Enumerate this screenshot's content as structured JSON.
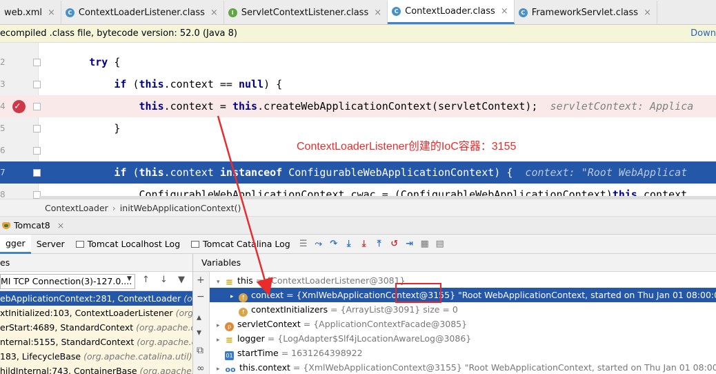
{
  "tabs": [
    {
      "label": "web.xml",
      "icon": "xml-icon"
    },
    {
      "label": "ContextLoaderListener.class",
      "icon": "class-icon"
    },
    {
      "label": "ServletContextListener.class",
      "icon": "interface-icon"
    },
    {
      "label": "ContextLoader.class",
      "icon": "class-icon",
      "active": true
    },
    {
      "label": "FrameworkServlet.class",
      "icon": "class-icon"
    }
  ],
  "infobar": {
    "message": "ecompiled .class file, bytecode version: 52.0 (Java 8)",
    "link": "Down"
  },
  "editor": {
    "lines": [
      {
        "num": "2",
        "indent": "        ",
        "parts": [
          {
            "k": "kw",
            "t": "try"
          },
          {
            "k": "t",
            "t": " {"
          }
        ]
      },
      {
        "num": "3",
        "indent": "            ",
        "parts": [
          {
            "k": "kw",
            "t": "if"
          },
          {
            "k": "t",
            "t": " ("
          },
          {
            "k": "kw",
            "t": "this"
          },
          {
            "k": "t",
            "t": ".context == "
          },
          {
            "k": "kw",
            "t": "null"
          },
          {
            "k": "t",
            "t": ") {"
          }
        ]
      },
      {
        "num": "4",
        "indent": "                ",
        "parts": [
          {
            "k": "kw",
            "t": "this"
          },
          {
            "k": "t",
            "t": ".context = "
          },
          {
            "k": "kw",
            "t": "this"
          },
          {
            "k": "t",
            "t": ".createWebApplicationContext(servletContext);  "
          },
          {
            "k": "hint",
            "t": "servletContext: Applica"
          }
        ],
        "breakpoint": true
      },
      {
        "num": "5",
        "indent": "            ",
        "parts": [
          {
            "k": "t",
            "t": "}"
          }
        ]
      },
      {
        "num": "6",
        "indent": "",
        "parts": []
      },
      {
        "num": "7",
        "indent": "            ",
        "parts": [
          {
            "k": "kw",
            "t": "if"
          },
          {
            "k": "t",
            "t": " ("
          },
          {
            "k": "kw",
            "t": "this"
          },
          {
            "k": "t",
            "t": ".context "
          },
          {
            "k": "kw",
            "t": "instanceof"
          },
          {
            "k": "t",
            "t": " ConfigurableWebApplicationContext) {  "
          },
          {
            "k": "hint",
            "t": "context: \"Root WebApplicat"
          }
        ],
        "current": true
      },
      {
        "num": "8",
        "indent": "                ",
        "parts": [
          {
            "k": "t",
            "t": "ConfigurableWebApplicationContext cwac = (ConfigurableWebApplicationContext)"
          },
          {
            "k": "kw",
            "t": "this"
          },
          {
            "k": "t",
            "t": ".context"
          }
        ]
      }
    ],
    "annotation": "ContextLoaderListener创建的IoC容器：3155"
  },
  "breadcrumb": [
    "ContextLoader",
    "initWebApplicationContext()"
  ],
  "debug": {
    "title": "Tomcat8",
    "tabs": [
      "gger",
      "Server",
      "Tomcat Localhost Log",
      "Tomcat Catalina Log"
    ],
    "frames_header": "es",
    "variables_header": "Variables",
    "thread": "MI TCP Connection(3)-127.0....",
    "frames": [
      {
        "name": "ebApplicationContext:281, ContextLoader ",
        "pkg": "(org.spr",
        "selected": true
      },
      {
        "name": "xtInitialized:103, ContextLoaderListener ",
        "pkg": "(org.spr"
      },
      {
        "name": "erStart:4689, StandardContext ",
        "pkg": "(org.apache.catal"
      },
      {
        "name": "nternal:5155, StandardContext ",
        "pkg": "(org.apache.catal"
      },
      {
        "name": "183, LifecycleBase ",
        "pkg": "(org.apache.catalina.util)"
      },
      {
        "name": "hildInternal:743, ContainerBase ",
        "pkg": "(org.apache.catal"
      }
    ],
    "variables": [
      {
        "indent": 0,
        "arrow": "▾",
        "badge": "eq",
        "badge_text": "≡",
        "name": "this",
        "value": " = {ContextLoaderListener@3081}"
      },
      {
        "indent": 1,
        "arrow": "▸",
        "badge": "f",
        "badge_text": "f",
        "name": "context",
        "value": " = {XmlWebApplicationContext@3155} \"Root WebApplicationContext, started on Thu Jan 01 08:00:00 CST 19",
        "selected": true
      },
      {
        "indent": 1,
        "arrow": "",
        "badge": "f",
        "badge_text": "f",
        "name": "contextInitializers",
        "value": " = {ArrayList@3091}  size = 0"
      },
      {
        "indent": 0,
        "arrow": "▸",
        "badge": "p",
        "badge_text": "p",
        "name": "servletContext",
        "value": " = {ApplicationContextFacade@3085}"
      },
      {
        "indent": 0,
        "arrow": "▸",
        "badge": "eq",
        "badge_text": "≡",
        "name": "logger",
        "value": " = {LogAdapter$Slf4jLocationAwareLog@3086}"
      },
      {
        "indent": 0,
        "arrow": "",
        "badge": "o1",
        "badge_text": "01",
        "name": "startTime",
        "value": " = 1631264398922"
      },
      {
        "indent": 0,
        "arrow": "▸",
        "badge": "oo",
        "badge_text": "oo",
        "name": "this.context",
        "value": " = {XmlWebApplicationContext@3155} \"Root WebApplicationContext, started on Thu Jan 01 08:00:00 CST 19"
      }
    ]
  },
  "colors": {
    "accent": "#2557a8",
    "annotation": "#e82c2c",
    "breakpoint": "#cc3a48"
  }
}
